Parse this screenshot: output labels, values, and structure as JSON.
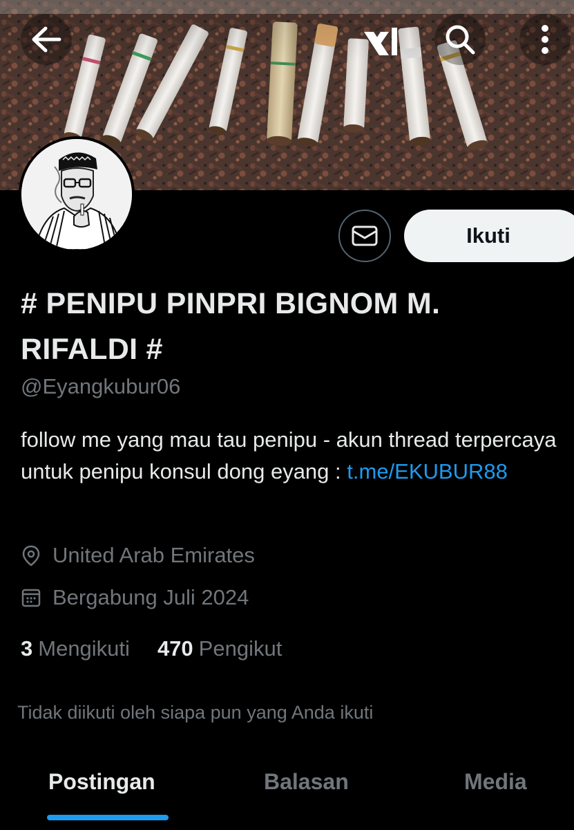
{
  "header": {
    "back_icon": "arrow-left-icon",
    "brand_icon": "xai-logo-icon",
    "search_icon": "search-icon",
    "more_icon": "more-vertical-icon"
  },
  "actions": {
    "message_icon": "envelope-icon",
    "follow_label": "Ikuti"
  },
  "profile": {
    "display_name": "# PENIPU PINPRI BIGNOM M. RIFALDI #",
    "handle": "@Eyangkubur06",
    "bio_text": "follow me yang mau tau penipu - akun thread terpercaya untuk penipu konsul dong eyang :",
    "bio_link": "t.me/EKUBUR88",
    "location": "United Arab Emirates",
    "joined": "Bergabung Juli 2024"
  },
  "stats": {
    "following_count": "3",
    "following_label": "Mengikuti",
    "followers_count": "470",
    "followers_label": "Pengikut"
  },
  "not_followed_text": "Tidak diikuti oleh siapa pun yang Anda ikuti",
  "tabs": [
    {
      "label": "Postingan",
      "active": true
    },
    {
      "label": "Balasan",
      "active": false
    },
    {
      "label": "Media",
      "active": false
    }
  ],
  "colors": {
    "background": "#000000",
    "text_primary": "#e7e9ea",
    "text_secondary": "#71767b",
    "accent": "#1d9bf0",
    "follow_button_bg": "#eff3f4"
  }
}
